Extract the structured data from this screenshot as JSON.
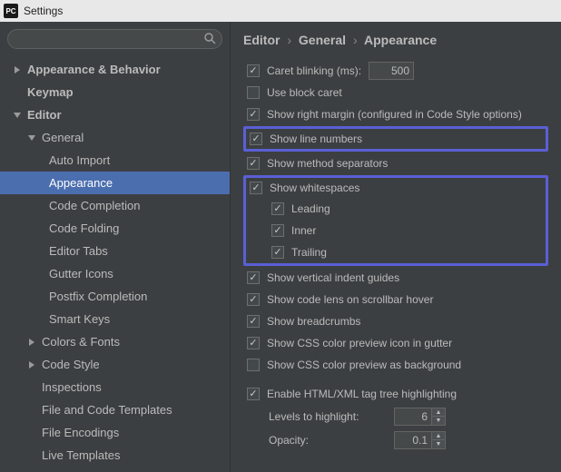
{
  "window": {
    "title": "Settings",
    "icon_label": "PC"
  },
  "search": {
    "placeholder": ""
  },
  "tree": {
    "appearance_behavior": "Appearance & Behavior",
    "keymap": "Keymap",
    "editor": "Editor",
    "general": "General",
    "auto_import": "Auto Import",
    "appearance": "Appearance",
    "code_completion": "Code Completion",
    "code_folding": "Code Folding",
    "editor_tabs": "Editor Tabs",
    "gutter_icons": "Gutter Icons",
    "postfix_completion": "Postfix Completion",
    "smart_keys": "Smart Keys",
    "colors_fonts": "Colors & Fonts",
    "code_style": "Code Style",
    "inspections": "Inspections",
    "file_code_templates": "File and Code Templates",
    "file_encodings": "File Encodings",
    "live_templates": "Live Templates"
  },
  "breadcrumb": {
    "a": "Editor",
    "b": "General",
    "c": "Appearance"
  },
  "options": {
    "caret_blinking": "Caret blinking (ms):",
    "caret_blinking_value": "500",
    "use_block_caret": "Use block caret",
    "show_right_margin": "Show right margin (configured in Code Style options)",
    "show_line_numbers": "Show line numbers",
    "show_method_separators": "Show method separators",
    "show_whitespaces": "Show whitespaces",
    "leading": "Leading",
    "inner": "Inner",
    "trailing": "Trailing",
    "show_vertical_indent_guides": "Show vertical indent guides",
    "show_code_lens": "Show code lens on scrollbar hover",
    "show_breadcrumbs": "Show breadcrumbs",
    "show_css_preview_gutter": "Show CSS color preview icon in gutter",
    "show_css_preview_bg": "Show CSS color preview as background",
    "enable_tag_tree": "Enable HTML/XML tag tree highlighting",
    "levels_label": "Levels to highlight:",
    "levels_value": "6",
    "opacity_label": "Opacity:",
    "opacity_value": "0.1"
  }
}
